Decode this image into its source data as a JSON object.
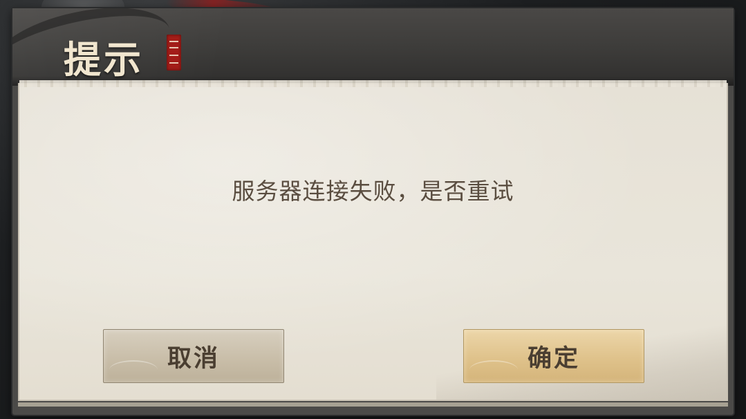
{
  "dialog": {
    "title": "提示",
    "seal_text": "",
    "message": "服务器连接失败，是否重试",
    "cancel_label": "取消",
    "confirm_label": "确定"
  },
  "colors": {
    "header_bg": "#3c3b39",
    "paper_bg": "#e8e3d8",
    "title_text": "#f1e6cf",
    "message_text": "#5a4d40",
    "cancel_button": "#c9bea9",
    "confirm_button": "#dfc28b",
    "seal_red": "#a31d18"
  },
  "icons": {
    "seal": "red-seal-stamp"
  }
}
